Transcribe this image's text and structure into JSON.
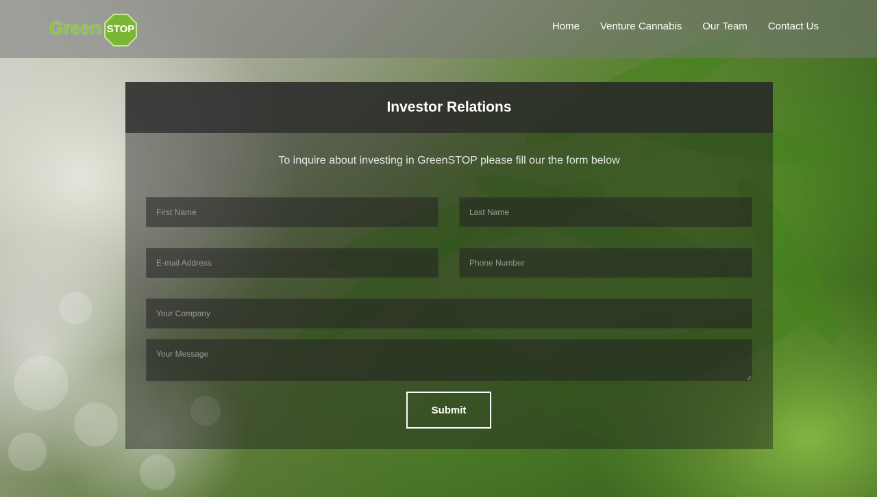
{
  "brand": {
    "logo_text": "Green",
    "logo_badge": "STOP"
  },
  "nav": {
    "items": [
      {
        "label": "Home"
      },
      {
        "label": "Venture Cannabis"
      },
      {
        "label": "Our Team"
      },
      {
        "label": "Contact Us"
      }
    ]
  },
  "panel": {
    "title": "Investor Relations",
    "intro": "To inquire about investing in GreenSTOP please fill our the form below"
  },
  "form": {
    "first_name_placeholder": "First Name",
    "last_name_placeholder": "Last Name",
    "email_placeholder": "E-mail Address",
    "phone_placeholder": "Phone Number",
    "company_placeholder": "Your Company",
    "message_placeholder": "Your Message",
    "submit_label": "Submit"
  },
  "colors": {
    "brand_green": "#8bc53f",
    "text_white": "#ffffff"
  }
}
